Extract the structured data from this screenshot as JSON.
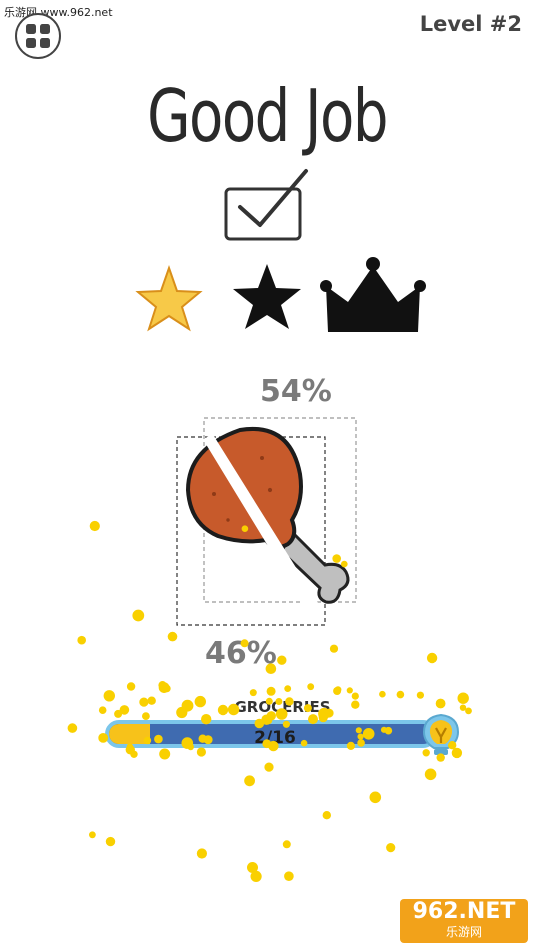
{
  "watermark": {
    "top_text": "乐游网 www.962.net",
    "logo_line1": "962.NET",
    "logo_line2": "乐游网"
  },
  "header": {
    "level": "Level #2"
  },
  "result": {
    "title": "Good Job"
  },
  "rating": {
    "stars_earned": 1,
    "items": [
      "star",
      "star",
      "crown"
    ]
  },
  "slice": {
    "top_percent": "54%",
    "bottom_percent": "46%"
  },
  "progress": {
    "label": "GROCERIES",
    "count": "2/16",
    "current": 2,
    "total": 16
  },
  "colors": {
    "star_gold": "#f7c948",
    "bar_blue": "#3f6bb0",
    "bar_border": "#7cc6ea",
    "drumstick": "#c75a2b",
    "confetti": "#f9d000"
  }
}
